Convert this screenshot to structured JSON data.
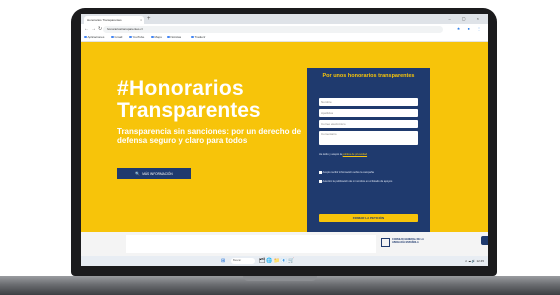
{
  "browser": {
    "tab_title": "Honorarios Transparentes",
    "tab_close": "×",
    "new_tab": "+",
    "window_controls": "–  ▢  ×",
    "nav_buttons": "←→↻",
    "url": "honorariostransparentes.cl",
    "extension_icons": "★ ● ⋮",
    "bookmarks": [
      "Aplicaciones",
      "Gmail",
      "YouTube",
      "Maps",
      "Noticias",
      "Traducir"
    ]
  },
  "hero": {
    "hashtag": "#Honorarios",
    "title": "Transparentes",
    "subtitle": "Transparencia sin sanciones: por un derecho de defensa seguro y claro para todos",
    "cta_icon": "🔍",
    "cta_label": "MÁS INFORMACIÓN"
  },
  "form": {
    "title": "Por unos honorarios transparentes",
    "fields": [
      {
        "placeholder": "Nombre"
      },
      {
        "placeholder": "Apellidos"
      },
      {
        "placeholder": "Correo electrónico"
      },
      {
        "placeholder": "Comentario"
      }
    ],
    "consent_text": "He leído y acepto la",
    "consent_link": "política de privacidad",
    "checks": [
      "Acepto recibir información sobre la campaña",
      "Autorizo la publicación de mi nombre en el listado de apoyos"
    ],
    "submit_label": "FIRMAR LA PETICIÓN"
  },
  "footer_strip": {
    "partner_name": "CONSEJO GENERAL DE LA ABOGACÍA ESPAÑOLA"
  },
  "taskbar": {
    "start": "⊞",
    "search_placeholder": "Buscar",
    "icons": "🗂🌐📁📧🛒",
    "tray": "∧ ☁ 🔊 12:45"
  }
}
